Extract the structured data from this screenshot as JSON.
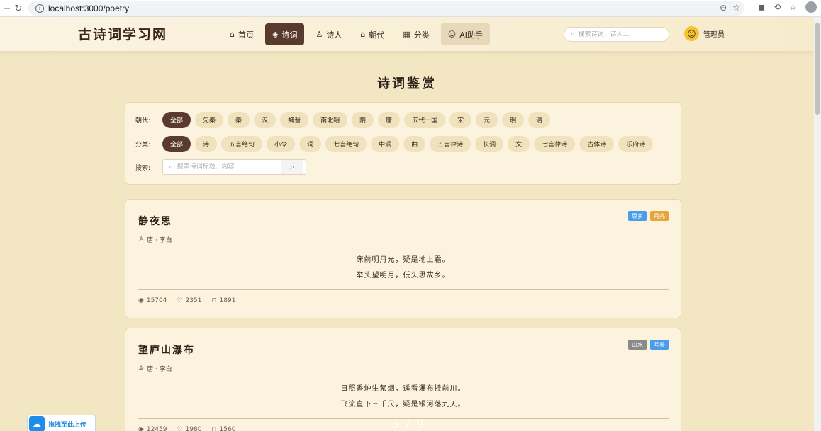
{
  "browser": {
    "url": "localhost:3000/poetry"
  },
  "header": {
    "logo": "古诗词学习网",
    "nav": [
      {
        "label": "首页",
        "icon": "home-icon",
        "glyph": "⌂"
      },
      {
        "label": "诗词",
        "icon": "layers-icon",
        "glyph": "◈"
      },
      {
        "label": "诗人",
        "icon": "person-icon",
        "glyph": "♙"
      },
      {
        "label": "朝代",
        "icon": "building-icon",
        "glyph": "⌂"
      },
      {
        "label": "分类",
        "icon": "grid-icon",
        "glyph": "▦"
      },
      {
        "label": "AI助手",
        "icon": "smile-icon",
        "glyph": "☺"
      }
    ],
    "search_placeholder": "搜索诗词、诗人...",
    "user_name": "管理员"
  },
  "page_title": "诗词鉴赏",
  "filters": {
    "dynasty_label": "朝代:",
    "dynasties": [
      "全部",
      "先秦",
      "秦",
      "汉",
      "魏晋",
      "南北朝",
      "隋",
      "唐",
      "五代十国",
      "宋",
      "元",
      "明",
      "清"
    ],
    "category_label": "分类:",
    "categories": [
      "全部",
      "诗",
      "五言绝句",
      "小令",
      "词",
      "七言绝句",
      "中调",
      "曲",
      "五言律诗",
      "长调",
      "文",
      "七言律诗",
      "古体诗",
      "乐府诗"
    ],
    "search_label": "搜索:",
    "search_placeholder": "搜索诗词标题、内容"
  },
  "poems": [
    {
      "title": "静夜思",
      "meta": "唐 · 李白",
      "tags": [
        {
          "label": "思乡",
          "color": "#4a9de8"
        },
        {
          "label": "月亮",
          "color": "#e3a53c"
        }
      ],
      "lines": [
        "床前明月光，疑是地上霜。",
        "举头望明月，低头思故乡。"
      ],
      "views": "15704",
      "likes": "2351",
      "favorites": "1891"
    },
    {
      "title": "望庐山瀑布",
      "meta": "唐 · 李白",
      "tags": [
        {
          "label": "山水",
          "color": "#8a8a8a"
        },
        {
          "label": "写景",
          "color": "#4a9de8"
        }
      ],
      "lines": [
        "日照香炉生紫烟，遥看瀑布挂前川。",
        "飞流直下三千尺，疑是银河落九天。"
      ],
      "views": "12459",
      "likes": "1980",
      "favorites": "1560"
    }
  ],
  "upload_widget": {
    "label": "拖拽至此上传"
  },
  "pager": "5 / 9"
}
